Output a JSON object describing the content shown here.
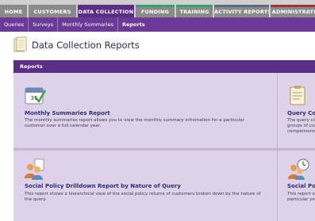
{
  "nav": {
    "tabs": [
      "HOME",
      "CUSTOMERS",
      "DATA COLLECTION",
      "FUNDING",
      "TRAINING",
      "ACTIVITY REPORTS",
      "ADMINISTRATION"
    ]
  },
  "subnav": {
    "items": [
      "Queries",
      "Surveys",
      "Monthly Summaries",
      "Reports"
    ]
  },
  "page": {
    "title": "Data Collection Reports"
  },
  "panel": {
    "header": "Reports",
    "cards": [
      {
        "title": "Monthly Summaries Report",
        "description": "The monthly summaries report allows you to view the monthly summary infromation for a particular customer over a full calendar year.",
        "icon": "calendar-check-icon"
      },
      {
        "title": "Query Comparis",
        "description": "The query comparison or groups of customer comparisons betwee",
        "icon": "clipboard-icon"
      },
      {
        "title": "Social Policy Drilldown Report by Nature of Query",
        "description": "This report shows a hierarchical view of the social policy returns of customers broken down by the nature of the query.",
        "icon": "people-document-icon"
      },
      {
        "title": "Social Polic",
        "description": "This report shows a particular year.",
        "icon": "people-clock-icon"
      }
    ]
  },
  "colors": {
    "purple": "#5b2e86",
    "subnav": "#6a3a96",
    "panel": "#dcd0e6",
    "title_blue": "#2c2f78"
  }
}
